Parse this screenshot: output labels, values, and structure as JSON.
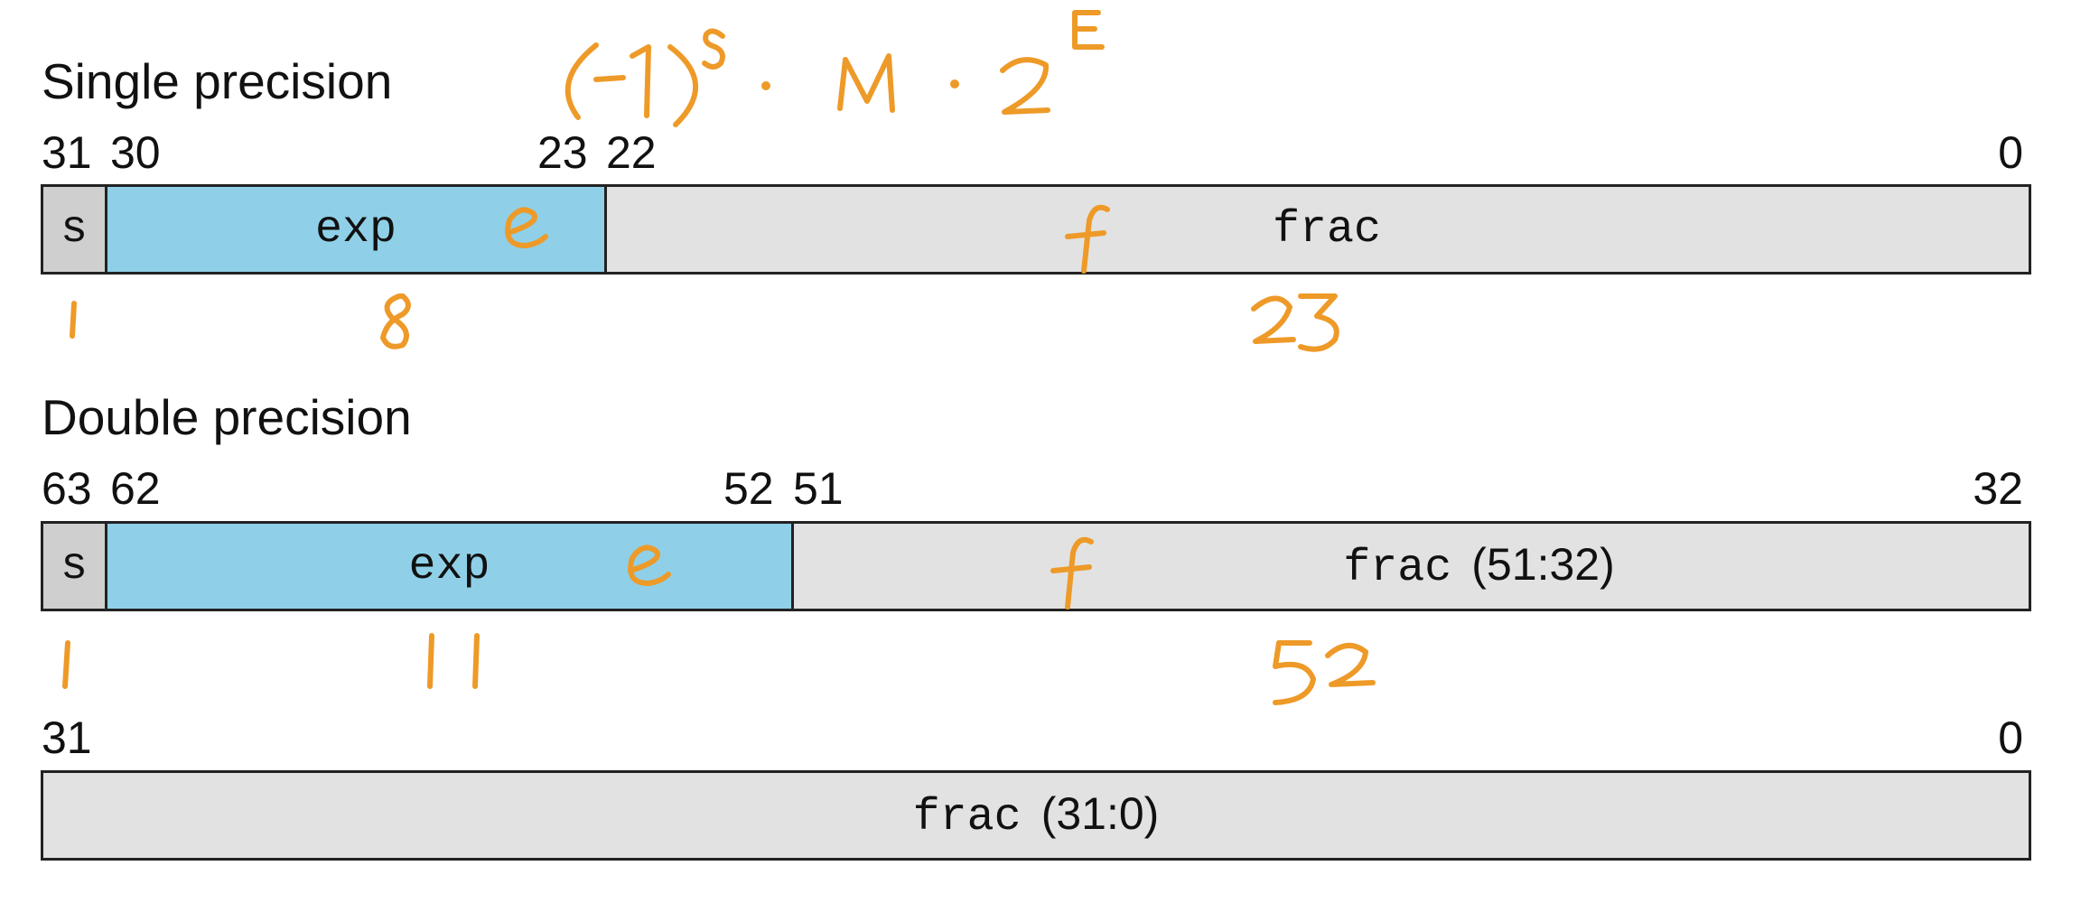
{
  "single": {
    "title": "Single precision",
    "bits": {
      "b31": "31",
      "b30": "30",
      "b23": "23",
      "b22": "22",
      "b0": "0"
    },
    "fields": {
      "sign": "s",
      "exp": "exp",
      "frac": "frac"
    }
  },
  "double": {
    "title": "Double precision",
    "bits_upper": {
      "b63": "63",
      "b62": "62",
      "b52": "52",
      "b51": "51",
      "b32": "32"
    },
    "fields": {
      "sign": "s",
      "exp": "exp",
      "frac_upper_code": "frac",
      "frac_upper_range": "(51:32)"
    },
    "bits_lower": {
      "b31": "31",
      "b0": "0"
    },
    "frac_lower_code": "frac",
    "frac_lower_range": "(31:0)"
  },
  "annotations": {
    "formula": "(-1)^s · M · 2^E",
    "single_field_labels": [
      "e",
      "f"
    ],
    "single_widths": [
      "1",
      "8",
      "23"
    ],
    "double_field_labels": [
      "e",
      "f"
    ],
    "double_widths": [
      "1",
      "11",
      "52"
    ],
    "ink_color": "#ee9a28"
  },
  "colors": {
    "sign_fill": "#cfcfcf",
    "exp_fill": "#8fd0e8",
    "frac_fill": "#e2e2e2"
  }
}
